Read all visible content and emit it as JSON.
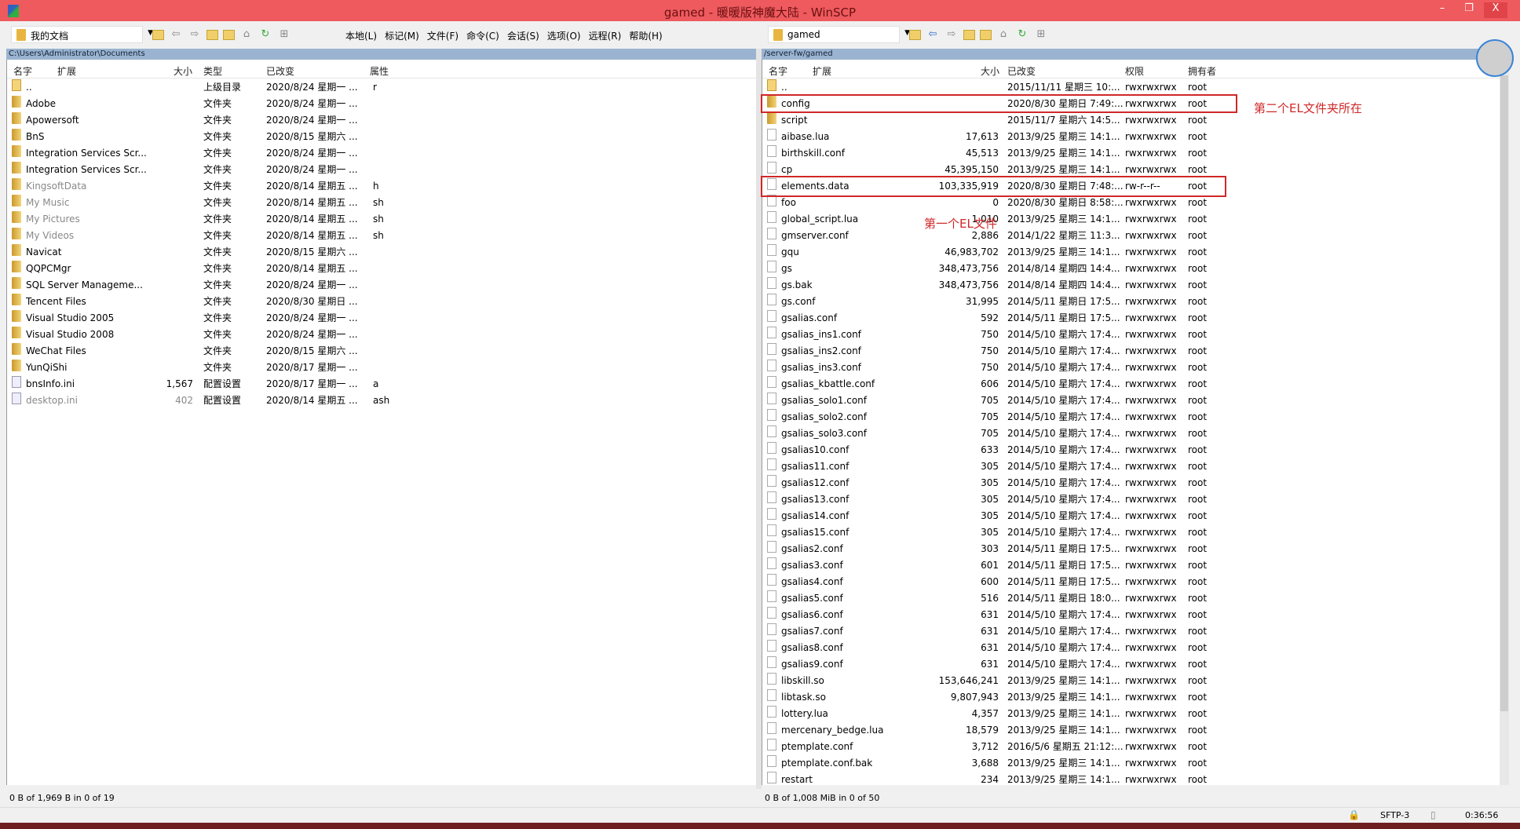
{
  "window": {
    "title": "gamed - 暖暖版神魔大陆 - WinSCP",
    "min": "–",
    "max": "❐",
    "close": "X"
  },
  "toolbar": {
    "left_drive": "我的文档",
    "right_drive": "gamed",
    "menu": [
      "本地(L)",
      "标记(M)",
      "文件(F)",
      "命令(C)",
      "会话(S)",
      "选项(O)",
      "远程(R)",
      "帮助(H)"
    ]
  },
  "left": {
    "path": "C:\\Users\\Administrator\\Documents",
    "columns": [
      "名字",
      "扩展",
      "大小",
      "类型",
      "已改变",
      "属性"
    ],
    "rows": [
      {
        "icon": "up",
        "name": "..",
        "size": "",
        "type": "上级目录",
        "date": "2020/8/24 星期一 ...",
        "attr": "r"
      },
      {
        "icon": "folder",
        "name": "Adobe",
        "size": "",
        "type": "文件夹",
        "date": "2020/8/24 星期一 ...",
        "attr": ""
      },
      {
        "icon": "folder",
        "name": "Apowersoft",
        "size": "",
        "type": "文件夹",
        "date": "2020/8/24 星期一 ...",
        "attr": ""
      },
      {
        "icon": "folder",
        "name": "BnS",
        "size": "",
        "type": "文件夹",
        "date": "2020/8/15 星期六 ...",
        "attr": ""
      },
      {
        "icon": "folder",
        "name": "Integration Services Scr...",
        "size": "",
        "type": "文件夹",
        "date": "2020/8/24 星期一 ...",
        "attr": ""
      },
      {
        "icon": "folder",
        "name": "Integration Services Scr...",
        "size": "",
        "type": "文件夹",
        "date": "2020/8/24 星期一 ...",
        "attr": ""
      },
      {
        "icon": "folder",
        "name": "KingsoftData",
        "size": "",
        "type": "文件夹",
        "date": "2020/8/14 星期五 ...",
        "attr": "h",
        "dim": true
      },
      {
        "icon": "folder",
        "name": "My Music",
        "size": "",
        "type": "文件夹",
        "date": "2020/8/14 星期五 ...",
        "attr": "sh",
        "dim": true
      },
      {
        "icon": "folder",
        "name": "My Pictures",
        "size": "",
        "type": "文件夹",
        "date": "2020/8/14 星期五 ...",
        "attr": "sh",
        "dim": true
      },
      {
        "icon": "folder",
        "name": "My Videos",
        "size": "",
        "type": "文件夹",
        "date": "2020/8/14 星期五 ...",
        "attr": "sh",
        "dim": true
      },
      {
        "icon": "folder",
        "name": "Navicat",
        "size": "",
        "type": "文件夹",
        "date": "2020/8/15 星期六 ...",
        "attr": ""
      },
      {
        "icon": "folder",
        "name": "QQPCMgr",
        "size": "",
        "type": "文件夹",
        "date": "2020/8/14 星期五 ...",
        "attr": ""
      },
      {
        "icon": "folder",
        "name": "SQL Server Manageme...",
        "size": "",
        "type": "文件夹",
        "date": "2020/8/24 星期一 ...",
        "attr": ""
      },
      {
        "icon": "folder",
        "name": "Tencent Files",
        "size": "",
        "type": "文件夹",
        "date": "2020/8/30 星期日 ...",
        "attr": ""
      },
      {
        "icon": "folder",
        "name": "Visual Studio 2005",
        "size": "",
        "type": "文件夹",
        "date": "2020/8/24 星期一 ...",
        "attr": ""
      },
      {
        "icon": "folder",
        "name": "Visual Studio 2008",
        "size": "",
        "type": "文件夹",
        "date": "2020/8/24 星期一 ...",
        "attr": ""
      },
      {
        "icon": "folder",
        "name": "WeChat Files",
        "size": "",
        "type": "文件夹",
        "date": "2020/8/15 星期六 ...",
        "attr": ""
      },
      {
        "icon": "folder",
        "name": "YunQiShi",
        "size": "",
        "type": "文件夹",
        "date": "2020/8/17 星期一 ...",
        "attr": ""
      },
      {
        "icon": "ini",
        "name": "bnsInfo.ini",
        "size": "1,567",
        "type": "配置设置",
        "date": "2020/8/17 星期一 ...",
        "attr": "a"
      },
      {
        "icon": "ini",
        "name": "desktop.ini",
        "size": "402",
        "type": "配置设置",
        "date": "2020/8/14 星期五 ...",
        "attr": "ash",
        "dim": true
      }
    ],
    "status": "0 B of 1,969 B in 0 of 19"
  },
  "right": {
    "path": "/server-fw/gamed",
    "columns": [
      "名字",
      "扩展",
      "大小",
      "已改变",
      "权限",
      "拥有者"
    ],
    "rows": [
      {
        "icon": "up",
        "name": "..",
        "size": "",
        "date": "2015/11/11 星期三 10:...",
        "perm": "rwxrwxrwx",
        "owner": "root"
      },
      {
        "icon": "folder",
        "name": "config",
        "size": "",
        "date": "2020/8/30 星期日 7:49:...",
        "perm": "rwxrwxrwx",
        "owner": "root"
      },
      {
        "icon": "folder",
        "name": "script",
        "size": "",
        "date": "2015/11/7 星期六 14:5...",
        "perm": "rwxrwxrwx",
        "owner": "root"
      },
      {
        "icon": "file",
        "name": "aibase.lua",
        "size": "17,613",
        "date": "2013/9/25 星期三 14:1...",
        "perm": "rwxrwxrwx",
        "owner": "root"
      },
      {
        "icon": "file",
        "name": "birthskill.conf",
        "size": "45,513",
        "date": "2013/9/25 星期三 14:1...",
        "perm": "rwxrwxrwx",
        "owner": "root"
      },
      {
        "icon": "file",
        "name": "cp",
        "size": "45,395,150",
        "date": "2013/9/25 星期三 14:1...",
        "perm": "rwxrwxrwx",
        "owner": "root"
      },
      {
        "icon": "file",
        "name": "elements.data",
        "size": "103,335,919",
        "date": "2020/8/30 星期日 7:48:...",
        "perm": "rw-r--r--",
        "owner": "root"
      },
      {
        "icon": "file",
        "name": "foo",
        "size": "0",
        "date": "2020/8/30 星期日 8:58:...",
        "perm": "rwxrwxrwx",
        "owner": "root"
      },
      {
        "icon": "file",
        "name": "global_script.lua",
        "size": "1,010",
        "date": "2013/9/25 星期三 14:1...",
        "perm": "rwxrwxrwx",
        "owner": "root"
      },
      {
        "icon": "file",
        "name": "gmserver.conf",
        "size": "2,886",
        "date": "2014/1/22 星期三 11:3...",
        "perm": "rwxrwxrwx",
        "owner": "root"
      },
      {
        "icon": "file",
        "name": "gqu",
        "size": "46,983,702",
        "date": "2013/9/25 星期三 14:1...",
        "perm": "rwxrwxrwx",
        "owner": "root"
      },
      {
        "icon": "file",
        "name": "gs",
        "size": "348,473,756",
        "date": "2014/8/14 星期四 14:4...",
        "perm": "rwxrwxrwx",
        "owner": "root"
      },
      {
        "icon": "file",
        "name": "gs.bak",
        "size": "348,473,756",
        "date": "2014/8/14 星期四 14:4...",
        "perm": "rwxrwxrwx",
        "owner": "root"
      },
      {
        "icon": "file",
        "name": "gs.conf",
        "size": "31,995",
        "date": "2014/5/11 星期日 17:5...",
        "perm": "rwxrwxrwx",
        "owner": "root"
      },
      {
        "icon": "file",
        "name": "gsalias.conf",
        "size": "592",
        "date": "2014/5/11 星期日 17:5...",
        "perm": "rwxrwxrwx",
        "owner": "root"
      },
      {
        "icon": "file",
        "name": "gsalias_ins1.conf",
        "size": "750",
        "date": "2014/5/10 星期六 17:4...",
        "perm": "rwxrwxrwx",
        "owner": "root"
      },
      {
        "icon": "file",
        "name": "gsalias_ins2.conf",
        "size": "750",
        "date": "2014/5/10 星期六 17:4...",
        "perm": "rwxrwxrwx",
        "owner": "root"
      },
      {
        "icon": "file",
        "name": "gsalias_ins3.conf",
        "size": "750",
        "date": "2014/5/10 星期六 17:4...",
        "perm": "rwxrwxrwx",
        "owner": "root"
      },
      {
        "icon": "file",
        "name": "gsalias_kbattle.conf",
        "size": "606",
        "date": "2014/5/10 星期六 17:4...",
        "perm": "rwxrwxrwx",
        "owner": "root"
      },
      {
        "icon": "file",
        "name": "gsalias_solo1.conf",
        "size": "705",
        "date": "2014/5/10 星期六 17:4...",
        "perm": "rwxrwxrwx",
        "owner": "root"
      },
      {
        "icon": "file",
        "name": "gsalias_solo2.conf",
        "size": "705",
        "date": "2014/5/10 星期六 17:4...",
        "perm": "rwxrwxrwx",
        "owner": "root"
      },
      {
        "icon": "file",
        "name": "gsalias_solo3.conf",
        "size": "705",
        "date": "2014/5/10 星期六 17:4...",
        "perm": "rwxrwxrwx",
        "owner": "root"
      },
      {
        "icon": "file",
        "name": "gsalias10.conf",
        "size": "633",
        "date": "2014/5/10 星期六 17:4...",
        "perm": "rwxrwxrwx",
        "owner": "root"
      },
      {
        "icon": "file",
        "name": "gsalias11.conf",
        "size": "305",
        "date": "2014/5/10 星期六 17:4...",
        "perm": "rwxrwxrwx",
        "owner": "root"
      },
      {
        "icon": "file",
        "name": "gsalias12.conf",
        "size": "305",
        "date": "2014/5/10 星期六 17:4...",
        "perm": "rwxrwxrwx",
        "owner": "root"
      },
      {
        "icon": "file",
        "name": "gsalias13.conf",
        "size": "305",
        "date": "2014/5/10 星期六 17:4...",
        "perm": "rwxrwxrwx",
        "owner": "root"
      },
      {
        "icon": "file",
        "name": "gsalias14.conf",
        "size": "305",
        "date": "2014/5/10 星期六 17:4...",
        "perm": "rwxrwxrwx",
        "owner": "root"
      },
      {
        "icon": "file",
        "name": "gsalias15.conf",
        "size": "305",
        "date": "2014/5/10 星期六 17:4...",
        "perm": "rwxrwxrwx",
        "owner": "root"
      },
      {
        "icon": "file",
        "name": "gsalias2.conf",
        "size": "303",
        "date": "2014/5/11 星期日 17:5...",
        "perm": "rwxrwxrwx",
        "owner": "root"
      },
      {
        "icon": "file",
        "name": "gsalias3.conf",
        "size": "601",
        "date": "2014/5/11 星期日 17:5...",
        "perm": "rwxrwxrwx",
        "owner": "root"
      },
      {
        "icon": "file",
        "name": "gsalias4.conf",
        "size": "600",
        "date": "2014/5/11 星期日 17:5...",
        "perm": "rwxrwxrwx",
        "owner": "root"
      },
      {
        "icon": "file",
        "name": "gsalias5.conf",
        "size": "516",
        "date": "2014/5/11 星期日 18:0...",
        "perm": "rwxrwxrwx",
        "owner": "root"
      },
      {
        "icon": "file",
        "name": "gsalias6.conf",
        "size": "631",
        "date": "2014/5/10 星期六 17:4...",
        "perm": "rwxrwxrwx",
        "owner": "root"
      },
      {
        "icon": "file",
        "name": "gsalias7.conf",
        "size": "631",
        "date": "2014/5/10 星期六 17:4...",
        "perm": "rwxrwxrwx",
        "owner": "root"
      },
      {
        "icon": "file",
        "name": "gsalias8.conf",
        "size": "631",
        "date": "2014/5/10 星期六 17:4...",
        "perm": "rwxrwxrwx",
        "owner": "root"
      },
      {
        "icon": "file",
        "name": "gsalias9.conf",
        "size": "631",
        "date": "2014/5/10 星期六 17:4...",
        "perm": "rwxrwxrwx",
        "owner": "root"
      },
      {
        "icon": "file",
        "name": "libskill.so",
        "size": "153,646,241",
        "date": "2013/9/25 星期三 14:1...",
        "perm": "rwxrwxrwx",
        "owner": "root"
      },
      {
        "icon": "file",
        "name": "libtask.so",
        "size": "9,807,943",
        "date": "2013/9/25 星期三 14:1...",
        "perm": "rwxrwxrwx",
        "owner": "root"
      },
      {
        "icon": "file",
        "name": "lottery.lua",
        "size": "4,357",
        "date": "2013/9/25 星期三 14:1...",
        "perm": "rwxrwxrwx",
        "owner": "root"
      },
      {
        "icon": "file",
        "name": "mercenary_bedge.lua",
        "size": "18,579",
        "date": "2013/9/25 星期三 14:1...",
        "perm": "rwxrwxrwx",
        "owner": "root"
      },
      {
        "icon": "file",
        "name": "ptemplate.conf",
        "size": "3,712",
        "date": "2016/5/6 星期五 21:12:...",
        "perm": "rwxrwxrwx",
        "owner": "root"
      },
      {
        "icon": "file",
        "name": "ptemplate.conf.bak",
        "size": "3,688",
        "date": "2013/9/25 星期三 14:1...",
        "perm": "rwxrwxrwx",
        "owner": "root"
      },
      {
        "icon": "file",
        "name": "restart",
        "size": "234",
        "date": "2013/9/25 星期三 14:1...",
        "perm": "rwxrwxrwx",
        "owner": "root"
      }
    ],
    "status": "0 B of 1,008 MiB in 0 of 50"
  },
  "annotations": {
    "second": "第二个EL文件夹所在",
    "first": "第一个EL文件",
    "color": "#d02828"
  },
  "bottom": {
    "protocol": "SFTP-3",
    "time": "0:36:56"
  }
}
